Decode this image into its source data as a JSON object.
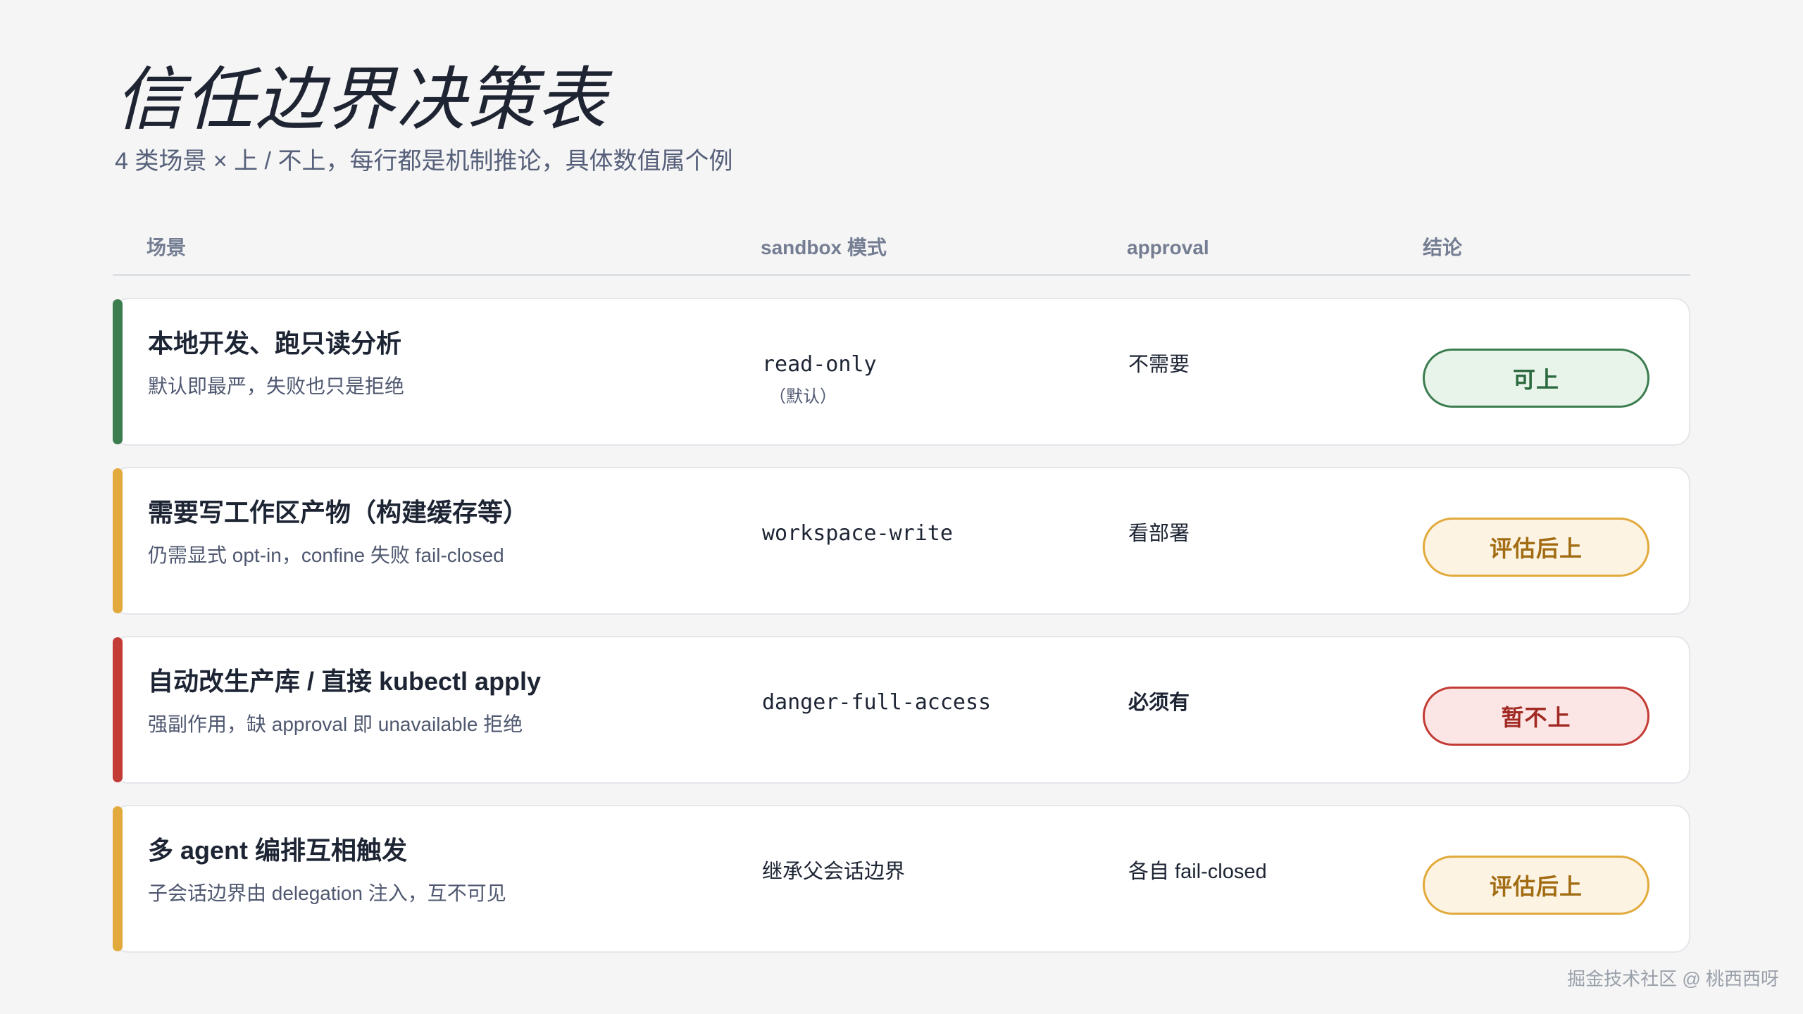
{
  "title": "信任边界决策表",
  "subtitle": "4 类场景 × 上 / 不上，每行都是机制推论，具体数值属个例",
  "columns": {
    "scene": "场景",
    "sandbox": "sandbox 模式",
    "approval": "approval",
    "verdict": "结论"
  },
  "colors": {
    "green": "#3b7d4e",
    "amber": "#e2aa3c",
    "red": "#c33b35"
  },
  "rows": [
    {
      "title": "本地开发、跑只读分析",
      "desc": "默认即最严，失败也只是拒绝",
      "mode": "read-only",
      "mode_note": "（默认）",
      "approval": "不需要",
      "verdict": "可上"
    },
    {
      "title": "需要写工作区产物（构建缓存等）",
      "desc": "仍需显式 opt-in，confine 失败 fail-closed",
      "mode": "workspace-write",
      "approval": "看部署",
      "verdict": "评估后上"
    },
    {
      "title": "自动改生产库 / 直接 kubectl apply",
      "desc": "强副作用，缺 approval 即 unavailable 拒绝",
      "mode": "danger-full-access",
      "approval": "必须有",
      "verdict": "暂不上"
    },
    {
      "title": "多 agent 编排互相触发",
      "desc": "子会话边界由 delegation 注入，互不可见",
      "mode": "继承父会话边界",
      "approval": "各自 fail-closed",
      "verdict": "评估后上"
    }
  ],
  "watermark": "掘金技术社区 @ 桃西西呀"
}
